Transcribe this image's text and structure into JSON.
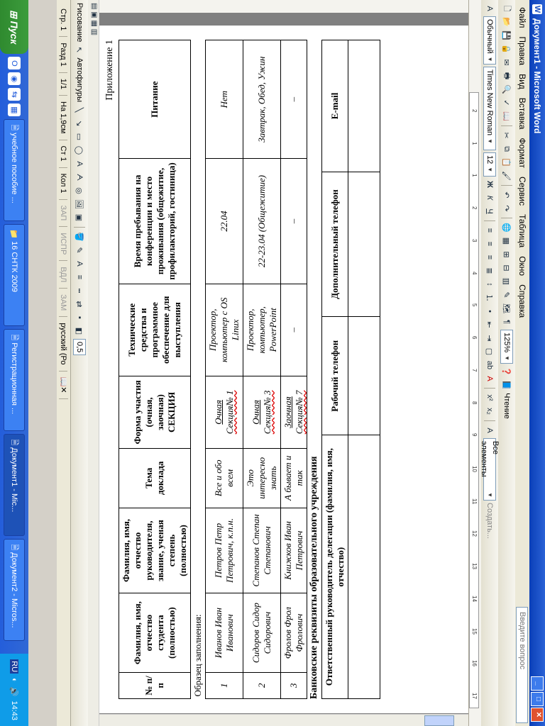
{
  "title": "Документ1 - Microsoft Word",
  "menu": [
    "Файл",
    "Правка",
    "Вид",
    "Вставка",
    "Формат",
    "Сервис",
    "Таблица",
    "Окно",
    "Справка"
  ],
  "help_box": "Введите вопрос",
  "toolbar": {
    "zoom": "125%",
    "reading": "Чтение",
    "style": "Обычный",
    "font": "Times New Roman",
    "size": "12",
    "bold": "Ж",
    "italic": "К",
    "underline": "Ч",
    "all_elements": "Все элементы",
    "create": "Создать..."
  },
  "ruler_numbers": [
    "2",
    "1",
    "1",
    "2",
    "3",
    "4",
    "5",
    "6",
    "7",
    "8",
    "9",
    "10",
    "11",
    "12",
    "13",
    "14",
    "15",
    "16",
    "17"
  ],
  "document": {
    "appendix": "Приложение 1",
    "headers": [
      "№ п/п",
      "Фамилия, имя, отчество студента (полностью)",
      "Фамилия, имя, отчество руководителя, звание, ученая степень (полностью)",
      "Тема доклада",
      "Форма участия (очная, заочная) СЕКЦИЯ",
      "Технические средства и программное обеспечение для выступления",
      "Время пребывания на конференции и место проживания (общежитие, профилакторий, гостиница)",
      "Питание"
    ],
    "sample_caption": "Образец заполнения:",
    "rows": [
      {
        "n": "1",
        "student": "Иванов Иван Иванович",
        "supervisor": "Петров Петр Петрович, к.п.н.",
        "topic": "Все и обо всем",
        "form": "Очная",
        "section": "Секция№ 1",
        "tech": "Проектор, компьютер с OS Linux",
        "stay": "22.04",
        "food": "Нет"
      },
      {
        "n": "2",
        "student": "Сидоров Сидор Сидорович",
        "supervisor": "Степанов Степан Степанович",
        "topic": "Это интересно знать",
        "form": "Очная",
        "section": "Секция№ 3",
        "tech": "Проектор, компьютер, PowerPoint",
        "stay": "22-23.04 (Общежитие)",
        "food": "Завтрак, Обед, Ужин"
      },
      {
        "n": "3",
        "student": "Фролов Фрол Фролович",
        "supervisor": "Книжков Иван Петрович",
        "topic": "А бывает и так",
        "form": "Заочная",
        "section": "Секция№ 7",
        "tech": "–",
        "stay": "–",
        "food": "–"
      }
    ],
    "bank_caption": "Банковские реквизиты образовательного учреждения",
    "contact_headers": [
      "Ответственный руководитель делегации (фамилия, имя, отчество)",
      "Рабочий телефон",
      "Дополнительный телефон",
      "E-mail"
    ]
  },
  "drawbar": {
    "draw": "Рисование",
    "autoshapes": "Автофигуры",
    "line_width": "0,5"
  },
  "status": {
    "page": "Стр. 1",
    "section": "Разд 1",
    "pages": "1/1",
    "pos": "На 1,9см",
    "line": "Ст 1",
    "col": "Кол 1",
    "rec": "ЗАП",
    "trk": "ИСПР",
    "ext": "ВДЛ",
    "ovr": "ЗАМ",
    "lang": "русский (Ро"
  },
  "taskbar": {
    "start": "Пуск",
    "tasks": [
      "учебное пособие ...",
      "16 СНТК 2009",
      "Регистрационная ...",
      "Документ1 - Mic...",
      "Документ2 - Micros..."
    ],
    "lang": "RU",
    "clock": "14:43"
  }
}
